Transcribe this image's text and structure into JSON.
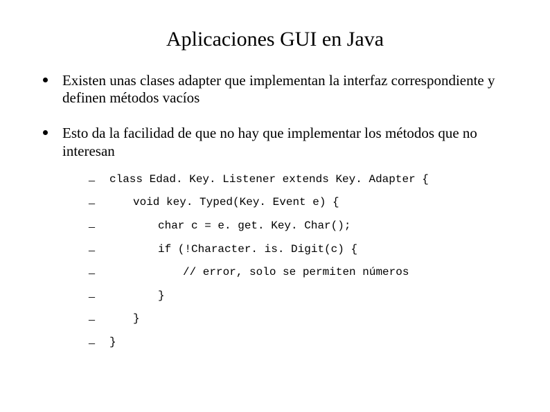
{
  "title": "Aplicaciones GUI en Java",
  "bullets": [
    "Existen unas clases adapter que implementan la interfaz correspondiente y definen métodos vacíos",
    "Esto da la facilidad de que no hay que implementar los métodos que no interesan"
  ],
  "code": {
    "l0": "class Edad. Key. Listener extends Key. Adapter {",
    "l1": "void key. Typed(Key. Event e) {",
    "l2": "char c = e. get. Key. Char();",
    "l3": "if (!Character. is. Digit(c) {",
    "l4": "// error, solo se permiten números",
    "l5": "}",
    "l6": "}",
    "l7": "}"
  }
}
